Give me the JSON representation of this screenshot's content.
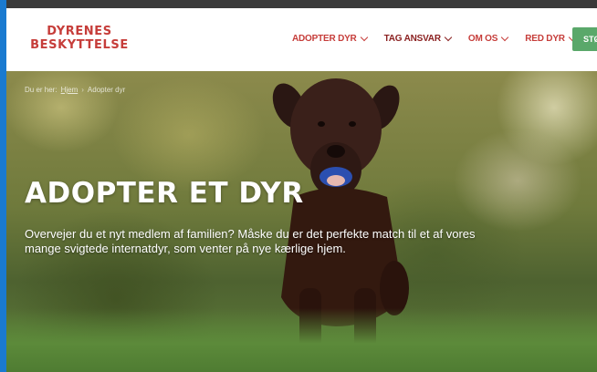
{
  "header": {
    "logo": {
      "line1": "DYRENES",
      "line2": "BESKYTTELSE"
    },
    "nav": [
      {
        "label": "ADOPTER DYR"
      },
      {
        "label": "TAG ANSVAR"
      },
      {
        "label": "OM OS"
      },
      {
        "label": "RED DYR"
      }
    ],
    "cta_label": "STØT"
  },
  "hero": {
    "breadcrumb": [
      "Du er her:",
      "Hjem",
      "Adopter dyr"
    ],
    "title": "ADOPTER ET DYR",
    "subtitle": "Overvejer du et nyt medlem af familien? Måske du er det perfekte match til et af vores mange svigtede internatdyr, som venter på nye kærlige hjem."
  },
  "colors": {
    "brand_red": "#c63d3a",
    "nav_dark_red": "#8a1f1f",
    "cta_green": "#5aa86a",
    "accent_blue": "#1a7ad0"
  }
}
